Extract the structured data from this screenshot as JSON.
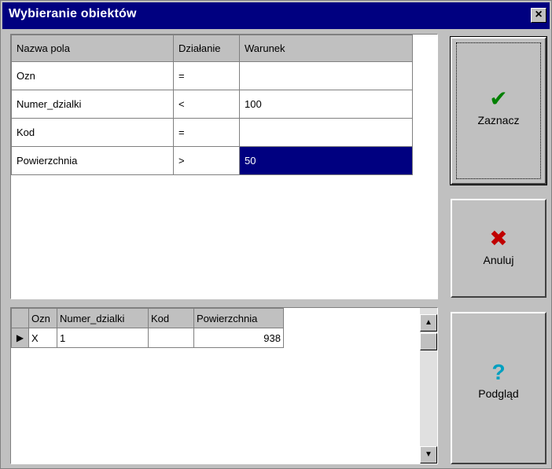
{
  "window": {
    "title": "Wybieranie obiektów",
    "close_glyph": "×"
  },
  "conditions": {
    "headers": [
      "Nazwa pola",
      "Działanie",
      "Warunek"
    ],
    "rows": [
      {
        "field": "Ozn",
        "op": "=",
        "value": ""
      },
      {
        "field": "Numer_dzialki",
        "op": "<",
        "value": "100"
      },
      {
        "field": "Kod",
        "op": "=",
        "value": ""
      },
      {
        "field": "Powierzchnia",
        "op": ">",
        "value": "50"
      }
    ]
  },
  "buttons": {
    "zaznacz": {
      "label": "Zaznacz",
      "icon": "check-icon"
    },
    "anuluj": {
      "label": "Anuluj",
      "icon": "x-icon"
    },
    "podglad": {
      "label": "Podgląd",
      "icon": "question-icon"
    }
  },
  "results": {
    "headers": [
      "",
      "Ozn",
      "Numer_dzialki",
      "Kod",
      "Powierzchnia"
    ],
    "rows": [
      {
        "indicator": "▶",
        "ozn": "X",
        "numer_dzialki": "1",
        "kod": "",
        "powierzchnia": "938"
      }
    ]
  },
  "colors": {
    "titlebar": "#000080",
    "selection": "#000080",
    "face": "#c0c0c0",
    "check": "#008000",
    "cancel": "#c00000",
    "question": "#00a0c0"
  }
}
